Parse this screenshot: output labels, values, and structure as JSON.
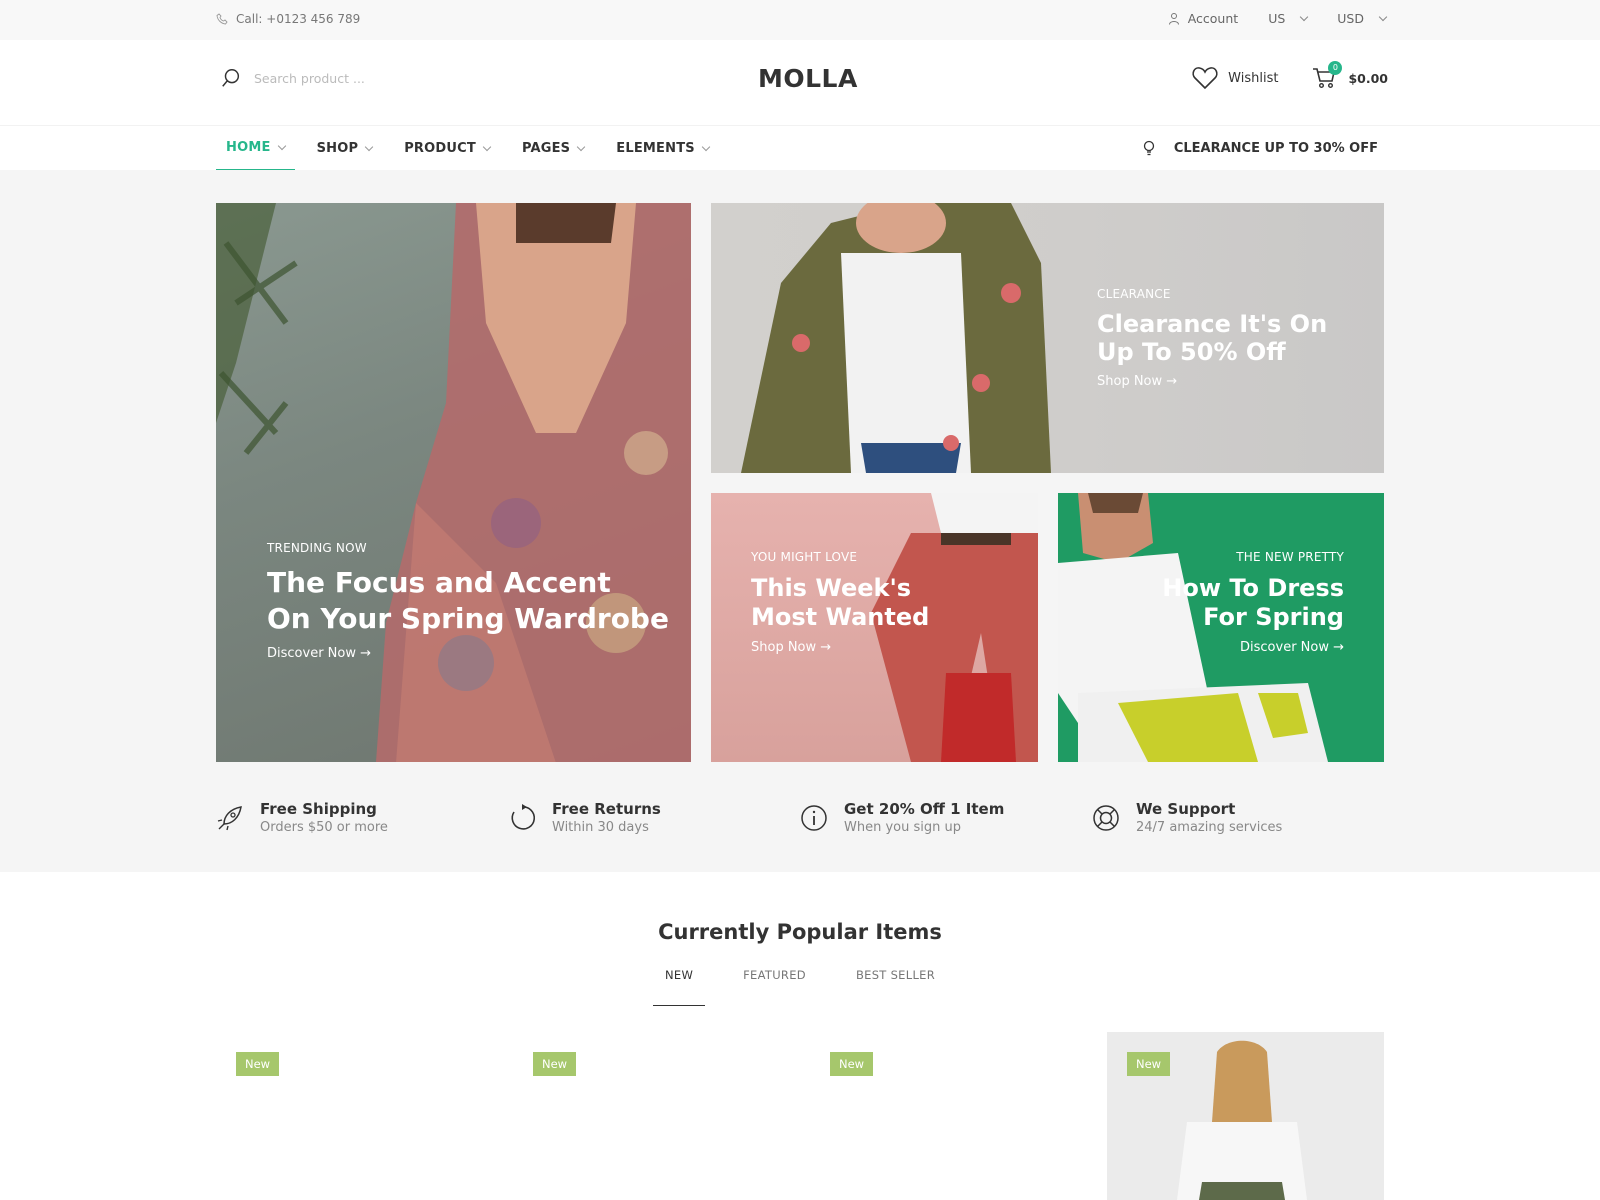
{
  "topbar": {
    "phone": "Call: +0123 456 789",
    "account": "Account",
    "language": "US",
    "currency": "USD"
  },
  "header": {
    "search_placeholder": "Search product ...",
    "logo": "MOLLA",
    "wishlist": "Wishlist",
    "cart_count": "0",
    "cart_total": "$0.00"
  },
  "nav": {
    "items": [
      {
        "label": "HOME"
      },
      {
        "label": "SHOP"
      },
      {
        "label": "PRODUCT"
      },
      {
        "label": "PAGES"
      },
      {
        "label": "ELEMENTS"
      }
    ],
    "promo": "CLEARANCE UP TO 30% OFF"
  },
  "banners": [
    {
      "subtitle": "TRENDING NOW",
      "title_line1": "The Focus and Accent",
      "title_line2": "On Your Spring Wardrobe",
      "link": "Discover Now →"
    },
    {
      "subtitle": "CLEARANCE",
      "title_line1": "Clearance It's On",
      "title_line2": "Up To 50% Off",
      "link": "Shop Now →"
    },
    {
      "subtitle": "YOU MIGHT LOVE",
      "title_line1": "This Week's",
      "title_line2": "Most Wanted",
      "link": "Shop Now →"
    },
    {
      "subtitle": "THE NEW PRETTY",
      "title_line1": "How To Dress",
      "title_line2": "For Spring",
      "link": "Discover Now →"
    }
  ],
  "features": [
    {
      "icon": "rocket-icon",
      "title": "Free Shipping",
      "desc": "Orders $50 or more"
    },
    {
      "icon": "rotate-icon",
      "title": "Free Returns",
      "desc": "Within 30 days"
    },
    {
      "icon": "info-icon",
      "title": "Get 20% Off 1 Item",
      "desc": "When you sign up"
    },
    {
      "icon": "lifebuoy-icon",
      "title": "We Support",
      "desc": "24/7 amazing services"
    }
  ],
  "popular": {
    "title": "Currently Popular Items",
    "tabs": [
      "NEW",
      "FEATURED",
      "BEST SELLER"
    ],
    "products": [
      {
        "badge": "New"
      },
      {
        "badge": "New"
      },
      {
        "badge": "New"
      },
      {
        "badge": "New"
      }
    ]
  },
  "colors": {
    "accent": "#26b68b",
    "badge_green": "#a6c76c",
    "banner_green": "#1f9b63"
  }
}
